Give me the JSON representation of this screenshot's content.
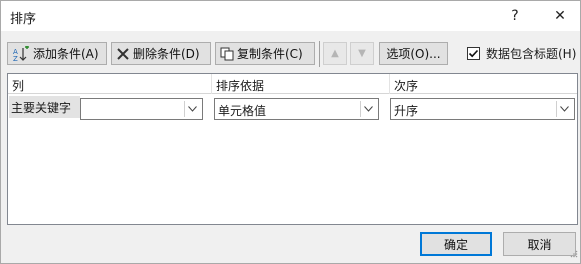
{
  "dialog": {
    "title": "排序",
    "help_label": "?",
    "close_label": "✕"
  },
  "toolbar": {
    "add_label": "添加条件(A)",
    "delete_label": "删除条件(D)",
    "copy_label": "复制条件(C)",
    "move_up_label": "▲",
    "move_down_label": "▼",
    "options_label": "选项(O)...",
    "header_checkbox_label": "数据包含标题(H)",
    "header_checkbox_checked": true
  },
  "grid": {
    "headers": [
      "列",
      "排序依据",
      "次序"
    ],
    "rows": [
      {
        "label": "主要关键字",
        "column_value": "",
        "sort_on_value": "单元格值",
        "order_value": "升序"
      }
    ]
  },
  "footer": {
    "ok_label": "确定",
    "cancel_label": "取消"
  },
  "colors": {
    "accent": "#0078d7",
    "dialog_bg": "#f0f0f0",
    "button_bg": "#e1e1e1"
  }
}
